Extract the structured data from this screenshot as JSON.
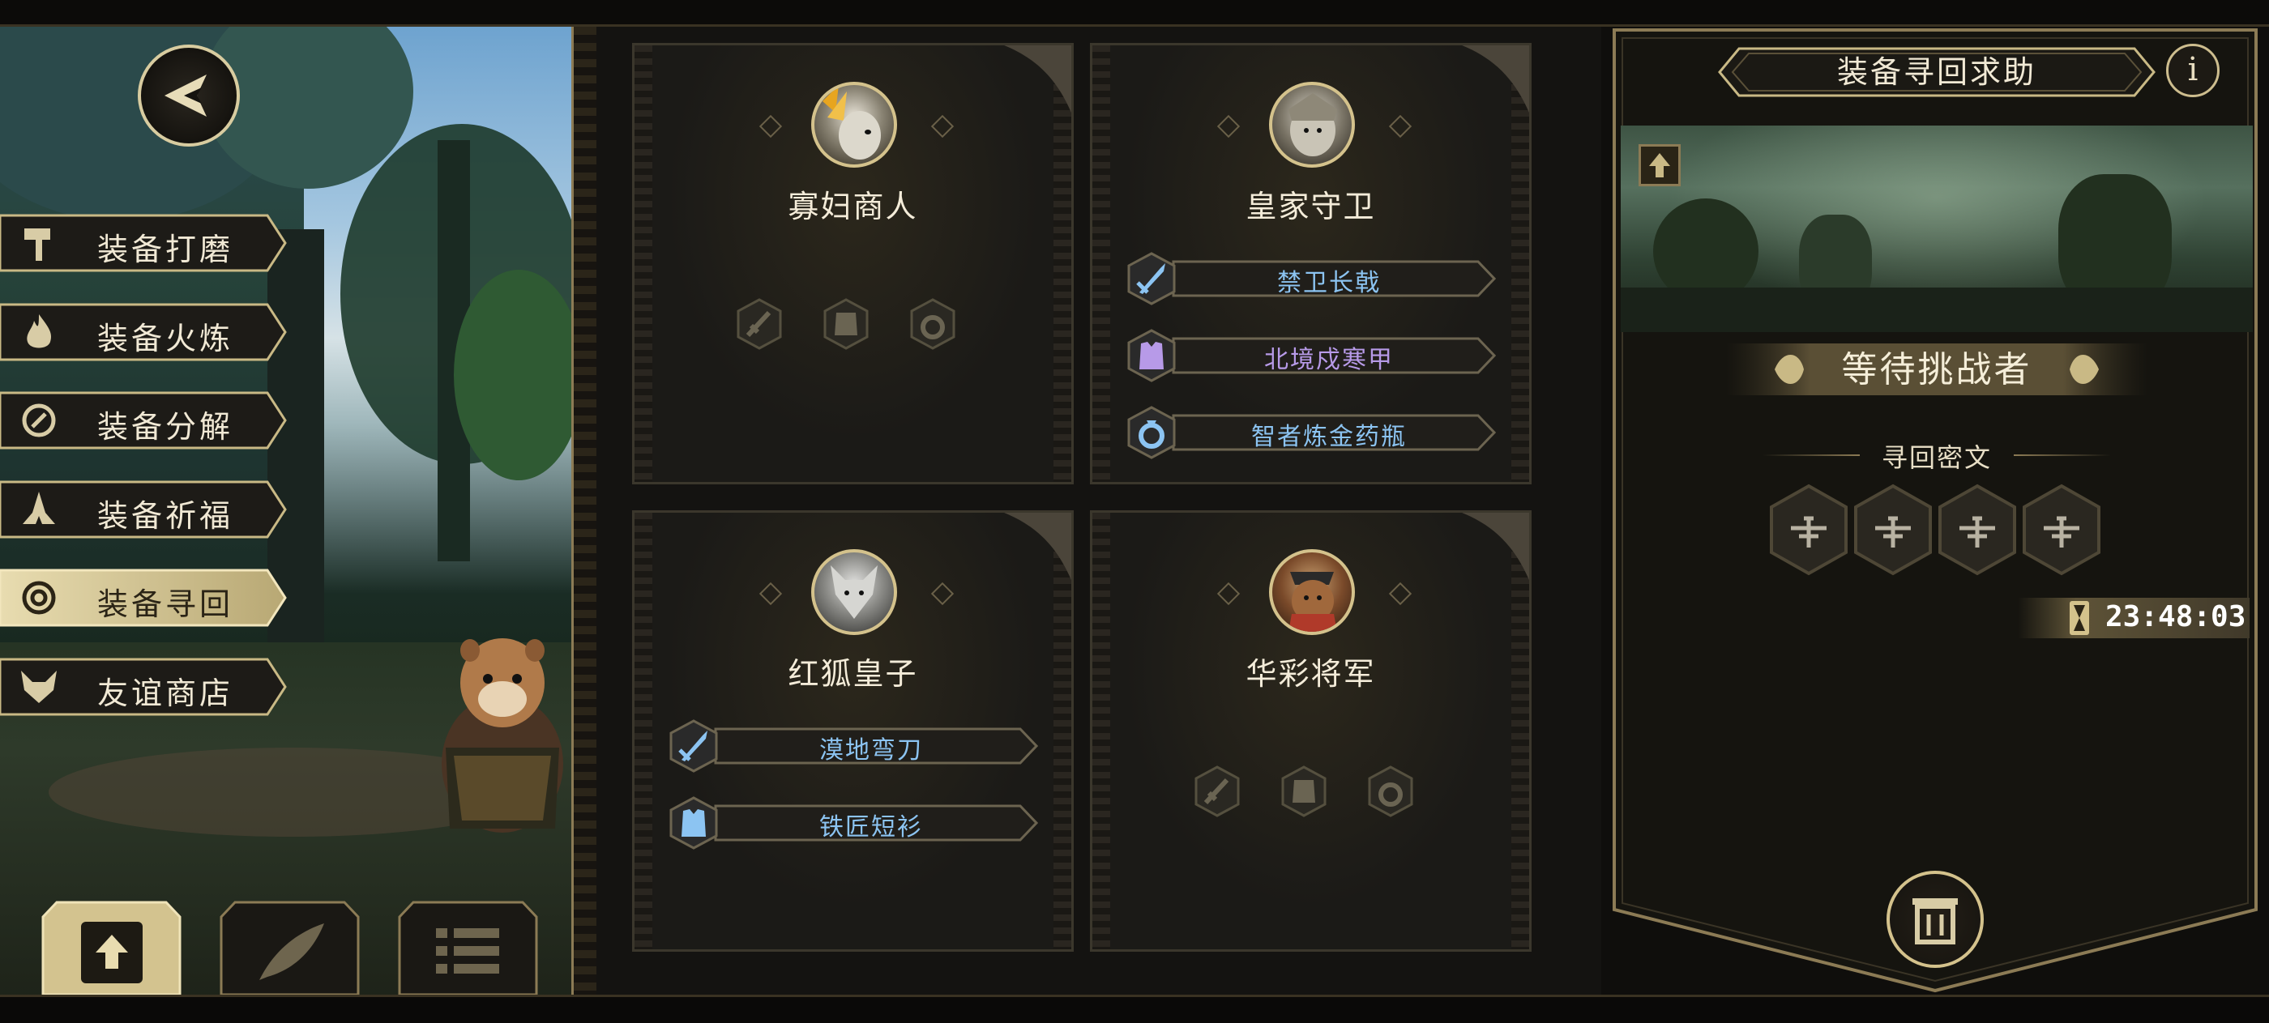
{
  "side_menu": {
    "items": [
      {
        "label": "装备打磨",
        "icon": "hammer-icon"
      },
      {
        "label": "装备火炼",
        "icon": "flame-icon"
      },
      {
        "label": "装备分解",
        "icon": "decompose-icon"
      },
      {
        "label": "装备祈福",
        "icon": "pray-hands-icon"
      },
      {
        "label": "装备寻回",
        "icon": "target-icon",
        "active": true
      },
      {
        "label": "友谊商店",
        "icon": "fox-icon"
      }
    ]
  },
  "bottom_tabs": [
    {
      "icon": "upload-icon",
      "active": true
    },
    {
      "icon": "feather-icon",
      "active": false
    },
    {
      "icon": "list-icon",
      "active": false
    }
  ],
  "cards": [
    {
      "name": "寡妇商人",
      "equipment": []
    },
    {
      "name": "皇家守卫",
      "equipment": [
        {
          "label": "禁卫长戟",
          "type": "weapon",
          "color": "#8cc4f2"
        },
        {
          "label": "北境戍寒甲",
          "type": "armor",
          "color": "#b79ae8"
        },
        {
          "label": "智者炼金药瓶",
          "type": "ring",
          "color": "#8cc4f2"
        }
      ]
    },
    {
      "name": "红狐皇子",
      "equipment": [
        {
          "label": "漠地弯刀",
          "type": "weapon",
          "color": "#8cc4f2"
        },
        {
          "label": "铁匠短衫",
          "type": "armor",
          "color": "#8cc4f2"
        }
      ]
    },
    {
      "name": "华彩将军",
      "equipment": []
    }
  ],
  "right_panel": {
    "title": "装备寻回求助",
    "info_label": "i",
    "status": "等待挑战者",
    "cipher_label": "寻回密文",
    "cipher_slots": 4,
    "timer": "23:48:03"
  },
  "colors": {
    "gold": "#d4c28c",
    "blue_item": "#8cc4f2",
    "purple_item": "#b79ae8"
  }
}
